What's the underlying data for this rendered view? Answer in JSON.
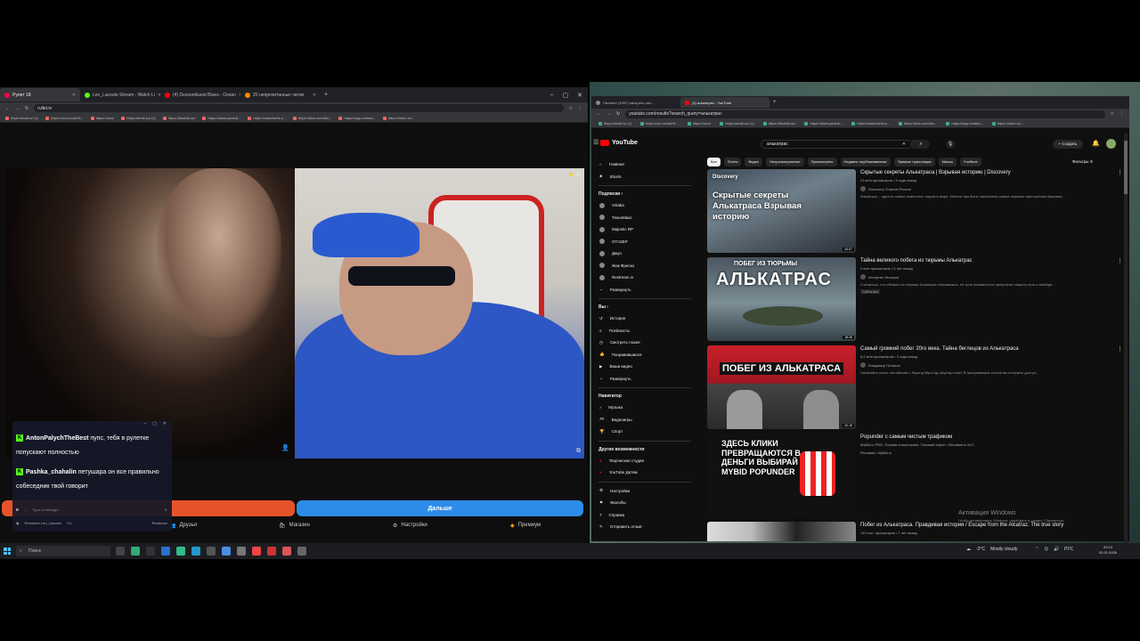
{
  "left_browser": {
    "tabs": [
      {
        "label": "Рулет 18",
        "active": true,
        "color": "#f04"
      },
      {
        "label": "Leo_Lacoste Stream - Watch Li",
        "active": false,
        "color": "#53fc18"
      },
      {
        "label": "(4) Dexsonbluest Blues - Ocean",
        "active": false,
        "color": "#f00"
      },
      {
        "label": "20 непрочитанных чатов",
        "active": false,
        "color": "#f80"
      }
    ],
    "url": "rullet.tv",
    "bookmarks": [
      "https://mail.ru/ (1)",
      "https://vk.com/al?8...",
      "https://olzu/",
      "https://amlli.su/ (1)",
      "https://twoklik.su/",
      "https://www.youtub...",
      "https://www.fonts.s...",
      "https://kick.com/leo...",
      "https://app.restrea...",
      "https://dzen.ru/..."
    ],
    "camera_count": "25",
    "next_button": "Дальше",
    "menu": {
      "friends": "Друзья",
      "shop": "Магазин",
      "settings": "Настройки",
      "premium": "Премиум"
    },
    "chat": {
      "messages": [
        {
          "user": "AntonPalychTheBest",
          "text": "пупс, тебя в рулетке попускают полностью"
        },
        {
          "user": "Pashka_chahalin",
          "text": "петушара он все правильно собеседник твой говорит"
        }
      ],
      "input_placeholder": "Type a message...",
      "footer_channel": "Restream Leo_Lacoste",
      "footer_count": "1/1",
      "footer_extra": "Restream"
    }
  },
  "right_browser": {
    "tabs": [
      {
        "label": "Пиланте (1997) смотреть онл...",
        "active": false,
        "color": "#888"
      },
      {
        "label": "(4) алькатрас - YouTube",
        "active": true,
        "color": "#f00"
      }
    ],
    "url": "youtube.com/results?search_query=алькатрас",
    "bookmarks": [
      "https://mail.ru/ (1)",
      "https://vk.com/al?8...",
      "https://olzu/",
      "https://amlli.su/ (1)",
      "https://twoklik.su/",
      "https://www.youtub...",
      "https://www.fonts.s...",
      "https://kick.com/leo...",
      "https://app.restrea...",
      "https://dzen.ru/..."
    ],
    "youtube": {
      "logo": "YouTube",
      "search_value": "алькатрас",
      "create_label": "Создать",
      "filters_label": "Фильтры",
      "sidebar": {
        "main": [
          "Главная",
          "Shorts"
        ],
        "subs_header": "Подписки",
        "subs": [
          "Vstaka",
          "ТехноМакс",
          "Majestic RP",
          "ОТАЗЕР",
          "Джун",
          "Жак Фреско",
          "Restream.io",
          "Развернуть"
        ],
        "you_header": "Вы",
        "you": [
          "История",
          "Плейлисты",
          "Смотреть позже",
          "Понравившиеся",
          "Ваши видео",
          "Развернуть"
        ],
        "nav_header": "Навигатор",
        "nav": [
          "Музыка",
          "Видеоигры",
          "Спорт"
        ],
        "more_header": "Другие возможности",
        "more": [
          "Творческая студия",
          "YouTube Детям"
        ],
        "settings": [
          "Настройки",
          "Жалобы",
          "Справка",
          "Отправить отзыв"
        ]
      },
      "chips": [
        "Все",
        "Shorts",
        "Видео",
        "Непросмотренные",
        "Просмотрено",
        "Недавно опубликованные",
        "Прямые трансляции",
        "Миксы",
        "Учебное"
      ],
      "videos": [
        {
          "title": "Скрытые секреты Алькатраса | Взрывая историю | Discovery",
          "stats": "23 млн просмотров • 3 года назад",
          "channel": "Discovery Channel Россия",
          "desc": "Алькатрас – одна из самых известных тюрем в мире. Многие там были заключены самые опасные преступники Америки...",
          "thumb_text": "Скрытые секреты Алькатраса Взрывая историю",
          "thumb_top": "Discovery",
          "duration": "44:07"
        },
        {
          "title": "Тайна великого побега из тюрьмы Алькатрас",
          "stats": "2 млн просмотров • 5 лет назад",
          "channel": "Интернет История",
          "desc": "Считалось, что сбежать из тюрьмы Алькатрас невозможно, но трое неизвестных преуспели открыть путь к свободе...",
          "thumb_text": "АЛЬКАТРАС",
          "thumb_top": "ПОБЕГ ИЗ ТЮРЬМЫ",
          "duration": "18:26",
          "badge": "Субтитры"
        },
        {
          "title": "Самый громкий побег 20го века. Тайна беглецов из Алькатраса",
          "stats": "6,2 млн просмотров • 3 года назад",
          "channel": "Владимир Потапов",
          "desc": "Начинайте учить английский с Skyeng https://go.skyeng.ru/vp2 В наступающем сезоне вы получите доступ...",
          "thumb_text": "ПОБЕГ ИЗ АЛЬКАТРАСА",
          "duration": "42:15"
        },
        {
          "title": "Popunder с самым чистым трафиком",
          "stats": "MyBid.io PRO. Попапы в вертикали. Топовый таргет. Обновлено 24/7.",
          "channel": "Реклама • MyBid.io",
          "desc": "",
          "thumb_text": "ЗДЕСЬ КЛИКИ ПРЕВРАЩАЮТСЯ В ДЕНЬГИ ВЫБИРАЙ MYBID POPUNDER",
          "duration": ""
        },
        {
          "title": "Побег из Алькатраса. Правдивая история / Escape from the Alcatraz. The true story",
          "stats": "143 тыс. просмотров • 7 лет назад",
          "channel": "",
          "desc": "",
          "thumb_text": "",
          "duration": ""
        }
      ]
    },
    "activation": {
      "title": "Активация Windows",
      "subtitle": "Чтобы активировать Windows, перейдите в раздел \"Параметры\"."
    }
  },
  "taskbar": {
    "search_placeholder": "Поиск",
    "weather": "Mostly cloudy",
    "temp": "-2°C",
    "lang": "РУС",
    "time": "20:13",
    "date": "01.01.2026"
  }
}
